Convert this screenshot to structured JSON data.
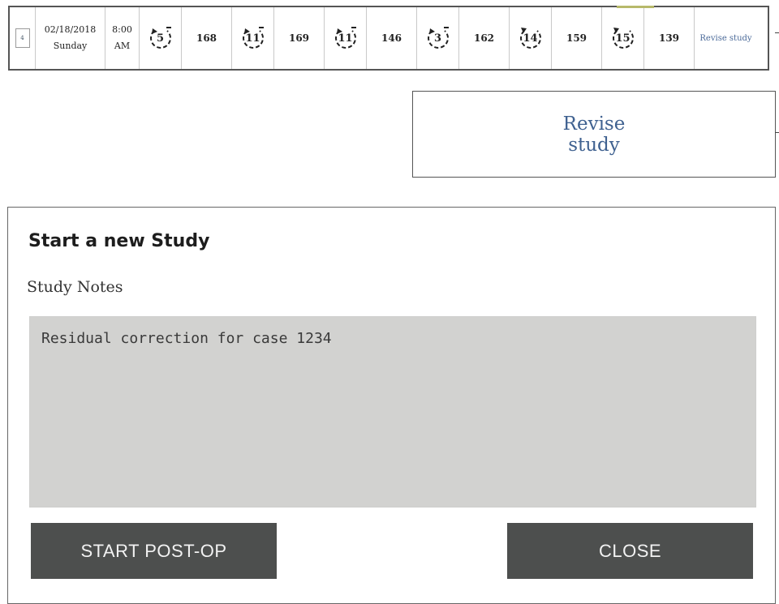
{
  "study_row": {
    "index": "4",
    "date": "02/18/2018",
    "weekday": "Sunday",
    "time": "8:00",
    "ampm": "AM",
    "cycles": [
      {
        "icon": "cycle-counterclockwise-icon",
        "count": "5",
        "value": "168"
      },
      {
        "icon": "cycle-counterclockwise-icon",
        "count": "11",
        "value": "169"
      },
      {
        "icon": "cycle-counterclockwise-icon",
        "count": "11",
        "value": "146"
      },
      {
        "icon": "cycle-counterclockwise-icon",
        "count": "3",
        "value": "162"
      },
      {
        "icon": "cycle-clockwise-icon",
        "count": "14",
        "value": "159"
      },
      {
        "icon": "cycle-clockwise-icon",
        "count": "15",
        "value": "139"
      }
    ],
    "revise_label": "Revise study"
  },
  "revise_box": {
    "line1": "Revise",
    "line2": "study"
  },
  "dialog": {
    "title": "Start a new Study",
    "notes_label": "Study Notes",
    "notes_value": "Residual correction for case 1234",
    "start_button": "START POST-OP",
    "close_button": "CLOSE"
  },
  "colors": {
    "button_bg": "#4d4f4e",
    "notes_bg": "#d2d2d0",
    "link_blue": "#3f6190",
    "accent": "#b7b96a"
  }
}
